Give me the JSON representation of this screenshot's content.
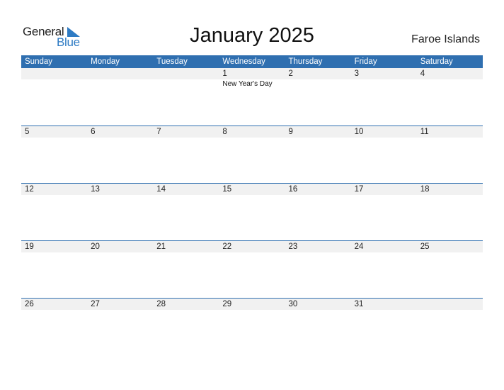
{
  "logo": {
    "general": "General",
    "blue": "Blue",
    "accent_color": "#2e7bc4"
  },
  "title": "January 2025",
  "country": "Faroe Islands",
  "header_color": "#2f6fb0",
  "weekdays": [
    "Sunday",
    "Monday",
    "Tuesday",
    "Wednesday",
    "Thursday",
    "Friday",
    "Saturday"
  ],
  "weeks": [
    {
      "days": [
        "",
        "",
        "",
        "1",
        "2",
        "3",
        "4"
      ],
      "events": [
        "",
        "",
        "",
        "New Year's Day",
        "",
        "",
        ""
      ]
    },
    {
      "days": [
        "5",
        "6",
        "7",
        "8",
        "9",
        "10",
        "11"
      ],
      "events": [
        "",
        "",
        "",
        "",
        "",
        "",
        ""
      ]
    },
    {
      "days": [
        "12",
        "13",
        "14",
        "15",
        "16",
        "17",
        "18"
      ],
      "events": [
        "",
        "",
        "",
        "",
        "",
        "",
        ""
      ]
    },
    {
      "days": [
        "19",
        "20",
        "21",
        "22",
        "23",
        "24",
        "25"
      ],
      "events": [
        "",
        "",
        "",
        "",
        "",
        "",
        ""
      ]
    },
    {
      "days": [
        "26",
        "27",
        "28",
        "29",
        "30",
        "31",
        ""
      ],
      "events": [
        "",
        "",
        "",
        "",
        "",
        "",
        ""
      ]
    }
  ]
}
